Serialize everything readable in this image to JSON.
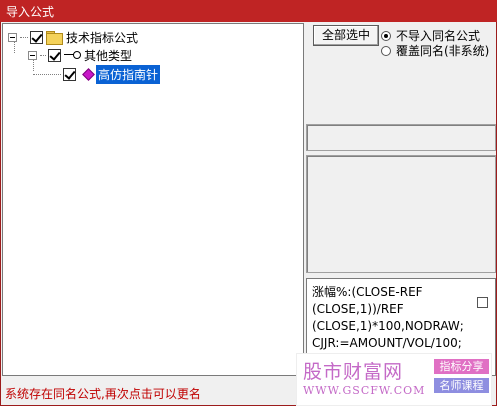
{
  "window": {
    "title": "导入公式"
  },
  "tree": {
    "items": [
      {
        "label": "技术指标公式",
        "checked": true,
        "icon": "folder-icon"
      },
      {
        "label": "其他类型",
        "checked": true,
        "icon": "key-icon"
      },
      {
        "label": "高仿指南针",
        "checked": true,
        "icon": "gem-icon",
        "selected": true
      }
    ]
  },
  "controls": {
    "select_all_label": "全部选中",
    "radio_options": [
      {
        "label": "不导入同名公式",
        "selected": true
      },
      {
        "label": "覆盖同名(非系统)",
        "selected": false
      }
    ]
  },
  "formula": {
    "lines": [
      "涨幅%:(CLOSE-REF",
      "(CLOSE,1))/REF",
      "(CLOSE,1)*100,NODRAW;",
      "CJJR:=AMOUNT/VOL/100;"
    ]
  },
  "watermark": {
    "title": "股市财富网",
    "url": "WWW.GSCFW.COM",
    "tag1": "指标分享",
    "tag2": "名师课程"
  },
  "status": {
    "message": "系统存在同名公式,再次点击可以更名"
  }
}
